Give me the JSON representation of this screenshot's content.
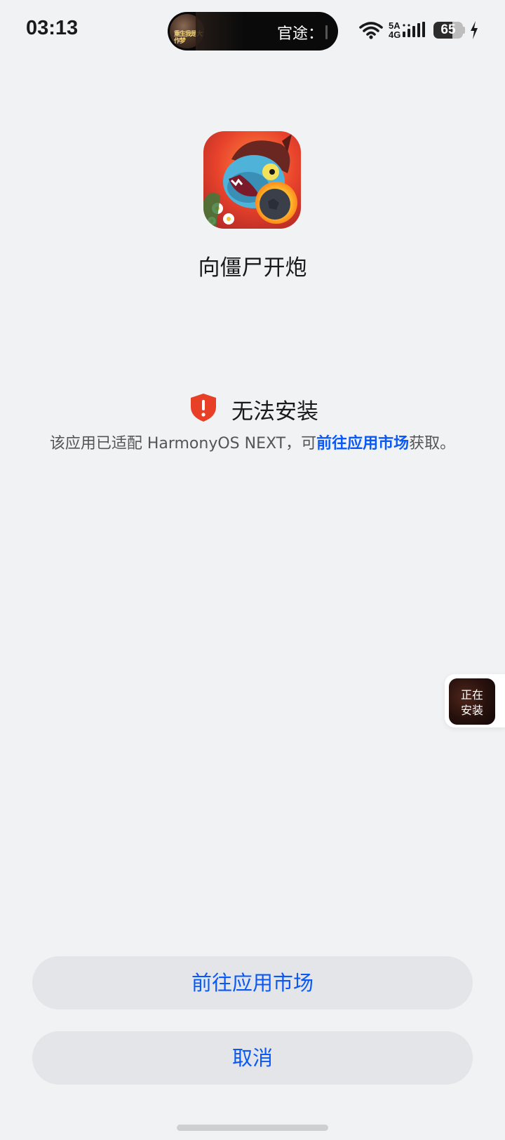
{
  "status_bar": {
    "time": "03:13",
    "island_text": "官途：",
    "avatar_caption": "重生我是大作梦",
    "network_label_top": "5A",
    "network_label_bottom": "4G",
    "battery_level": 65,
    "battery_text": "65",
    "icons": [
      "wifi-icon",
      "signal-icon",
      "battery-icon",
      "charging-bolt-icon"
    ]
  },
  "app": {
    "name": "向僵尸开炮",
    "icon": "zombie-game-app-icon"
  },
  "warning": {
    "icon": "shield-alert-icon",
    "title": "无法安装",
    "desc_prefix": "该应用已适配 HarmonyOS NEXT，可",
    "desc_link": "前往应用市场",
    "desc_suffix": "获取。"
  },
  "floating": {
    "line1": "正在",
    "line2": "安装"
  },
  "buttons": {
    "market": "前往应用市场",
    "cancel": "取消"
  },
  "colors": {
    "accent": "#0a59f7",
    "background": "#f1f2f4",
    "button_bg": "#e4e5e8",
    "shield": "#e84026"
  }
}
